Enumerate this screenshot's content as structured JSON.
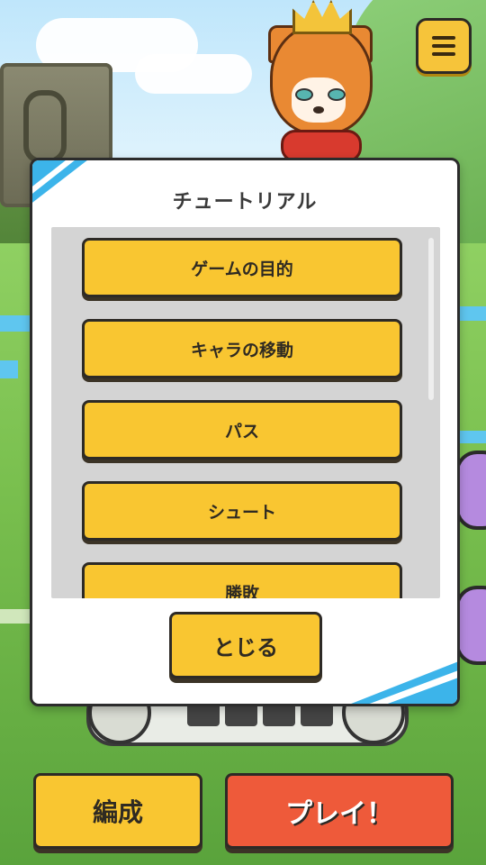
{
  "dialog": {
    "title": "チュートリアル",
    "items": [
      {
        "label": "ゲームの目的"
      },
      {
        "label": "キャラの移動"
      },
      {
        "label": "パス"
      },
      {
        "label": "シュート"
      },
      {
        "label": "勝敗"
      }
    ],
    "close_label": "とじる"
  },
  "bottom_bar": {
    "formation_label": "編成",
    "play_label": "プレイ！"
  },
  "icons": {
    "menu": "hamburger-menu-icon"
  },
  "colors": {
    "button_yellow": "#f9c631",
    "play_red": "#ee5a3a",
    "accent_blue": "#3cb4ea"
  }
}
